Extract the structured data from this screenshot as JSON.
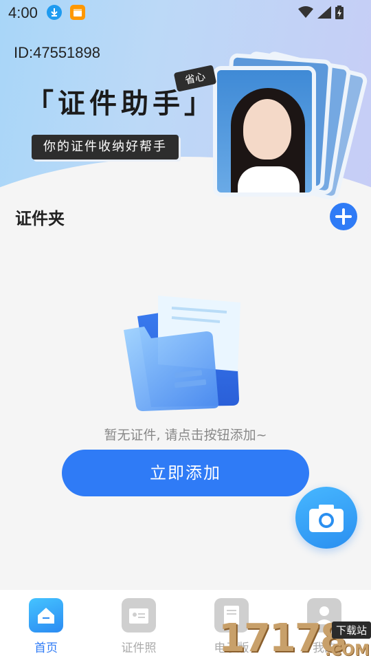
{
  "status_bar": {
    "time": "4:00"
  },
  "banner": {
    "user_id": "ID:47551898",
    "title": "「证件助手」",
    "tag": "省心",
    "slogan": "你的证件收纳好帮手"
  },
  "folder_section": {
    "title": "证件夹"
  },
  "empty_state": {
    "message": "暂无证件, 请点击按钮添加~",
    "button_label": "立即添加"
  },
  "bottom_nav": {
    "items": [
      {
        "label": "首页",
        "icon": "home-icon",
        "active": true
      },
      {
        "label": "证件照",
        "icon": "id-card-icon",
        "active": false
      },
      {
        "label": "电子版",
        "icon": "document-icon",
        "active": false
      },
      {
        "label": "我的",
        "icon": "user-icon",
        "active": false
      }
    ]
  },
  "watermark": {
    "digits": "17178",
    "tag": "下载站",
    "suffix": ".COM"
  },
  "colors": {
    "accent": "#2f7bf6",
    "banner_start": "#a8d6f8",
    "banner_end": "#c7cdf6"
  }
}
